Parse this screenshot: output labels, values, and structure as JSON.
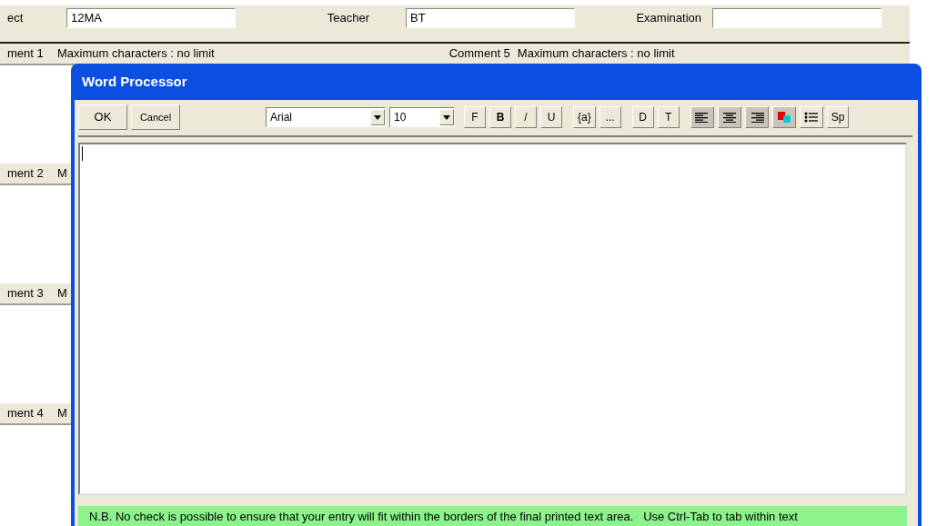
{
  "header": {
    "fields": [
      {
        "label": "ect",
        "value": "12MA"
      },
      {
        "label": "Teacher",
        "value": "BT"
      },
      {
        "label": "Examination"
      }
    ]
  },
  "comments": [
    {
      "label": "ment 1",
      "hint": "Maximum characters : no limit"
    },
    {
      "label": "ment 2",
      "hint": "M"
    },
    {
      "label": "ment 3",
      "hint": "M"
    },
    {
      "label": "ment 4",
      "hint": "M"
    }
  ],
  "comment_5": {
    "label": "Comment 5",
    "hint": "Maximum characters : no limit"
  },
  "dialog": {
    "title": "Word Processor",
    "buttons": [
      "OK",
      "Cancel"
    ],
    "font": "Arial",
    "size": "10",
    "tools": [
      {
        "kind": "text",
        "label": "F",
        "bold": false
      },
      {
        "kind": "text",
        "label": "B",
        "bold": true
      },
      {
        "kind": "text",
        "label": "/",
        "bold": false
      },
      {
        "kind": "text",
        "label": "U",
        "bold": false
      },
      {
        "kind": "text",
        "label": "{a}",
        "bold": false
      },
      {
        "kind": "text",
        "label": "...",
        "bold": false
      },
      {
        "kind": "text",
        "label": "D",
        "bold": false
      },
      {
        "kind": "text",
        "label": "T",
        "bold": false
      },
      {
        "kind": "align-left"
      },
      {
        "kind": "align-center"
      },
      {
        "kind": "align-right"
      },
      {
        "kind": "color"
      },
      {
        "kind": "list"
      },
      {
        "kind": "text",
        "label": "Sp",
        "bold": false
      }
    ],
    "note": "N.B. No check is possible to ensure that your entry will fit within the borders of the final printed text area.   Use Ctrl-Tab to tab within text"
  }
}
